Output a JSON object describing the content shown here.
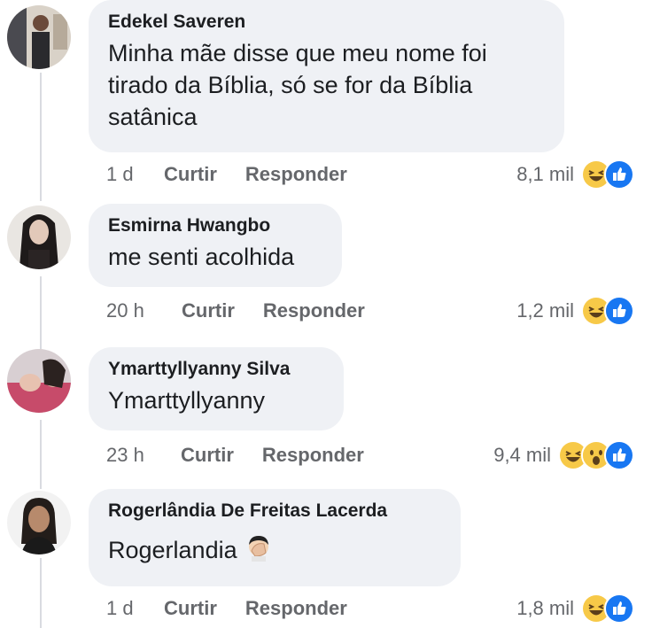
{
  "comments": [
    {
      "author": "Edekel Saveren",
      "text_lines": [
        "Minha mãe disse que meu nome foi",
        "tirado da Bíblia, só se for da Bíblia",
        "satânica"
      ],
      "time": "1 d",
      "like_label": "Curtir",
      "reply_label": "Responder",
      "reaction_count": "8,1 mil",
      "reactions": [
        "haha-icon",
        "like-icon"
      ]
    },
    {
      "author": "Esmirna Hwangbo",
      "text_lines": [
        "me senti acolhida"
      ],
      "time": "20 h",
      "like_label": "Curtir",
      "reply_label": "Responder",
      "reaction_count": "1,2 mil",
      "reactions": [
        "haha-icon",
        "like-icon"
      ]
    },
    {
      "author": "Ymarttyllyanny Silva",
      "text_lines": [
        "Ymarttyllyanny"
      ],
      "time": "23 h",
      "like_label": "Curtir",
      "reply_label": "Responder",
      "reaction_count": "9,4 mil",
      "reactions": [
        "haha-icon",
        "wow-icon",
        "like-icon"
      ]
    },
    {
      "author": "Rogerlândia De Freitas Lacerda",
      "text_lines": [
        "Rogerlandia"
      ],
      "text_emoji": "facepalm-emoji-icon",
      "time": "1 d",
      "like_label": "Curtir",
      "reply_label": "Responder",
      "reaction_count": "1,8 mil",
      "reactions": [
        "haha-icon",
        "like-icon"
      ]
    }
  ],
  "colors": {
    "bubble_bg": "#eff1f5",
    "text": "#1c1e21",
    "meta": "#65676b",
    "like_blue": "#1877f2",
    "haha_yellow": "#f7c948"
  }
}
